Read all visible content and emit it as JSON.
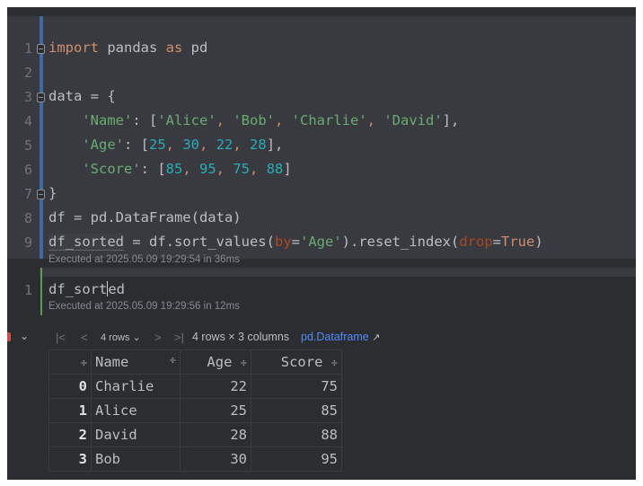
{
  "cell1": {
    "lines": [
      {
        "num": "1"
      },
      {
        "num": "2"
      },
      {
        "num": "3"
      },
      {
        "num": "4"
      },
      {
        "num": "5"
      },
      {
        "num": "6"
      },
      {
        "num": "7"
      },
      {
        "num": "8"
      },
      {
        "num": "9"
      }
    ],
    "tokens": {
      "import_kw": "import",
      "pandas": " pandas ",
      "as_kw": "as",
      "pd": " pd",
      "data_assign": "data = {",
      "name_key": "'Name'",
      "name_colon": ": [",
      "alice": "'Alice'",
      "bob": "'Bob'",
      "charlie": "'Charlie'",
      "david": "'David'",
      "name_end": "],",
      "age_key": "'Age'",
      "age_colon": ": [",
      "age_vals": [
        "25",
        "30",
        "22",
        "28"
      ],
      "age_end": "],",
      "score_key": "'Score'",
      "score_colon": ": [",
      "score_vals": [
        "85",
        "95",
        "75",
        "88"
      ],
      "score_end": "]",
      "close_brace": "}",
      "line8": "df = pd.DataFrame(data)",
      "df_sorted": "df_sorted",
      "l9_mid": " = df.sort_values(",
      "by_param": "by",
      "eq": "=",
      "age_str": "'Age'",
      "l9_mid2": ").reset_index(",
      "drop_param": "drop",
      "true_kw": "True",
      "l9_end": ")"
    },
    "executed": "Executed at 2025.05.09 19:29:54 in 36ms"
  },
  "cell2": {
    "line_num": "1",
    "code_before_caret": "df_sort",
    "code_after_caret": "ed",
    "executed": "Executed at 2025.05.09 19:29:56 in 12ms"
  },
  "output": {
    "rows_dropdown": "4 rows",
    "summary": "4 rows × 3 columns",
    "type_link": "pd.Dataframe",
    "link_arrow": "↗",
    "nav": {
      "first": "|<",
      "prev": "<",
      "next": ">",
      "last": ">|"
    },
    "columns": [
      "Name",
      "Age",
      "Score"
    ],
    "rows": [
      {
        "index": "0",
        "Name": "Charlie",
        "Age": "22",
        "Score": "75"
      },
      {
        "index": "1",
        "Name": "Alice",
        "Age": "25",
        "Score": "85"
      },
      {
        "index": "2",
        "Name": "David",
        "Age": "28",
        "Score": "88"
      },
      {
        "index": "3",
        "Name": "Bob",
        "Age": "30",
        "Score": "95"
      }
    ]
  }
}
